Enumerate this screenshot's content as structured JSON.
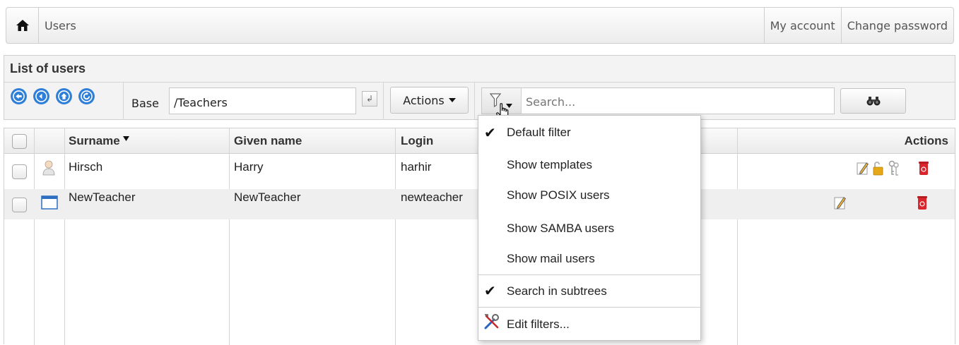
{
  "topbar": {
    "home_icon": "home-icon",
    "breadcrumb": "Users",
    "links": [
      "My account",
      "Change password"
    ]
  },
  "panel": {
    "title": "List of users",
    "nav_icons": [
      "back-icon",
      "forward-icon",
      "up-icon",
      "refresh-icon"
    ],
    "base_label": "Base",
    "base_value": "/Teachers",
    "actions_label": "Actions",
    "search_placeholder": "Search...",
    "search_icon": "binoculars-icon"
  },
  "table": {
    "headers": {
      "surname": "Surname",
      "given_name": "Given name",
      "login": "Login",
      "actions": "Actions"
    },
    "rows": [
      {
        "type_icon": "user-icon",
        "surname": "Hirsch",
        "given_name": "Harry",
        "login": "harhir",
        "actions": [
          "edit-icon",
          "unlock-icon",
          "keys-icon",
          "delete-icon"
        ]
      },
      {
        "type_icon": "template-icon",
        "surname": "NewTeacher",
        "given_name": "NewTeacher",
        "login": "newteacher",
        "actions": [
          "edit-icon",
          "delete-icon"
        ]
      }
    ]
  },
  "filter_menu": {
    "items": [
      {
        "label": "Default filter",
        "checked": true
      },
      {
        "label": "Show templates",
        "checked": false
      },
      {
        "label": "Show POSIX users",
        "checked": false
      },
      {
        "label": "Show SAMBA users",
        "checked": false
      },
      {
        "label": "Show mail users",
        "checked": false
      }
    ],
    "search_subtrees": {
      "label": "Search in subtrees",
      "checked": true
    },
    "edit_filters": {
      "label": "Edit filters...",
      "icon": "tools-icon"
    }
  },
  "colors": {
    "nav_blue": "#2f7fd8",
    "delete_red": "#d9262c",
    "lock_yellow": "#e6a817"
  }
}
